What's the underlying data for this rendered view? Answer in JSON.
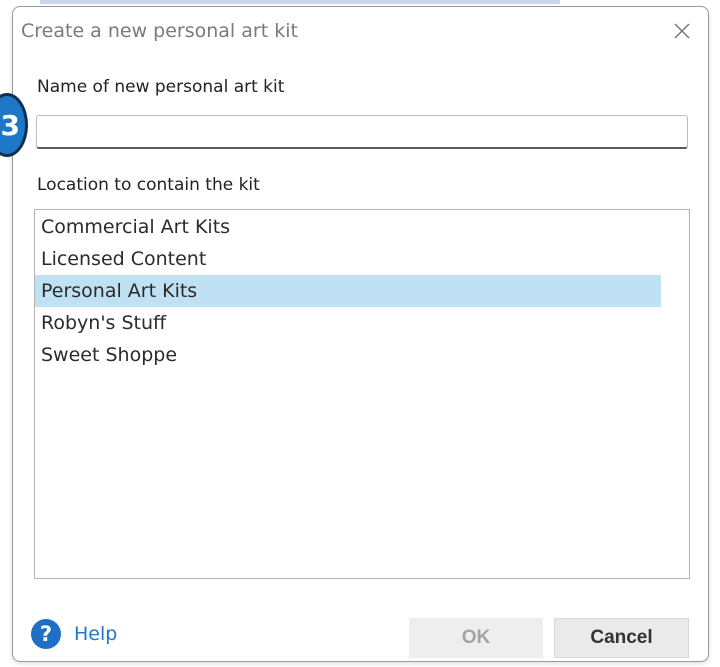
{
  "dialog": {
    "title": "Create a new personal art kit",
    "close_icon": "close-icon"
  },
  "name_field": {
    "label": "Name of new personal art kit",
    "value": "",
    "placeholder": ""
  },
  "step_badge": {
    "text": "3",
    "color": "#1e78c7"
  },
  "location": {
    "label": "Location to contain the kit",
    "items": [
      {
        "label": "Commercial Art Kits",
        "selected": false
      },
      {
        "label": "Licensed Content",
        "selected": false
      },
      {
        "label": "Personal Art Kits",
        "selected": true
      },
      {
        "label": "Robyn's Stuff",
        "selected": false
      },
      {
        "label": "Sweet Shoppe",
        "selected": false
      }
    ],
    "selected_color": "#bfe1f3"
  },
  "footer": {
    "help_icon": "help-icon",
    "help_label": "Help",
    "ok_label": "OK",
    "cancel_label": "Cancel"
  }
}
